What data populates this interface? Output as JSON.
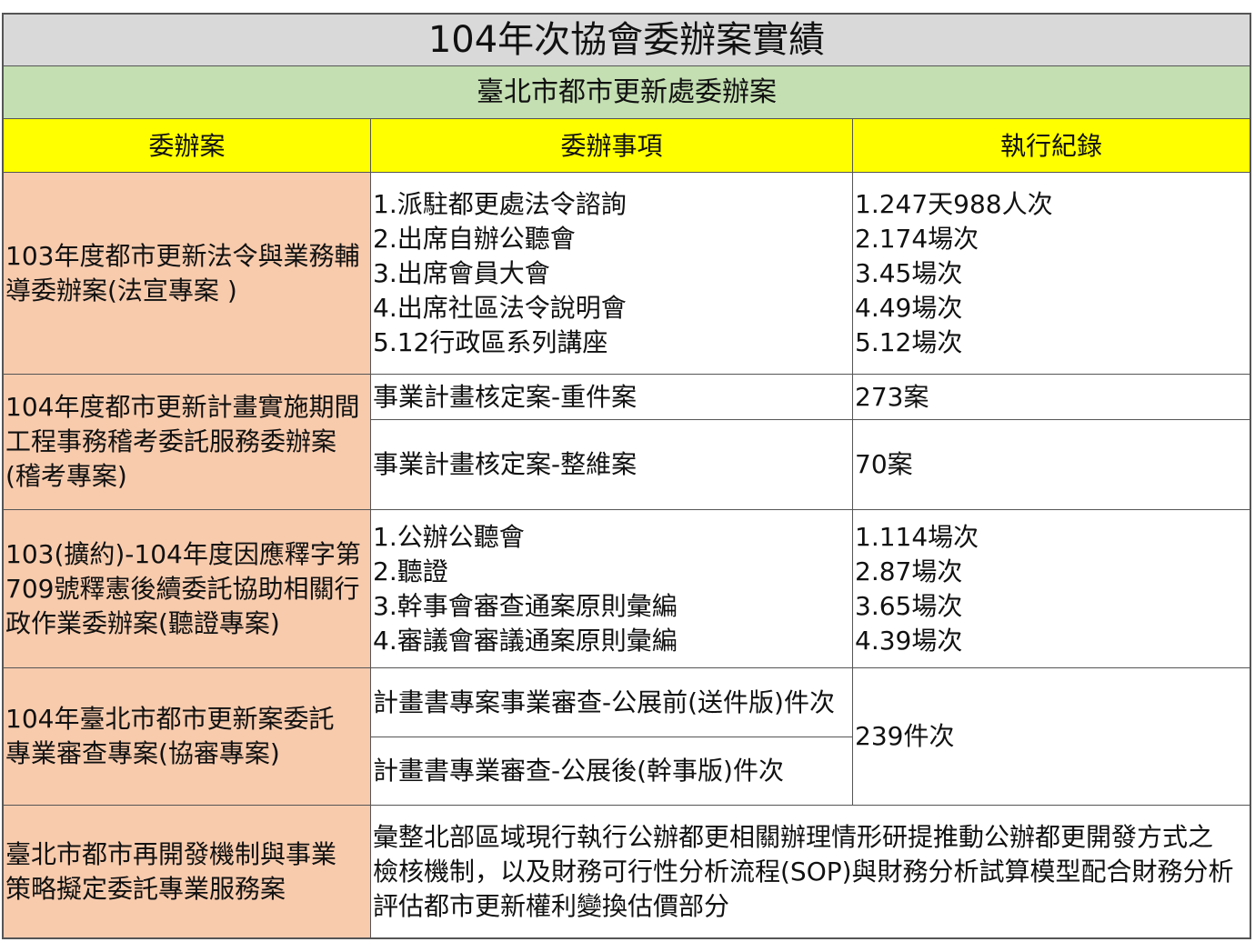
{
  "title": "104年次協會委辦案實績",
  "subtitle": "臺北市都市更新處委辦案",
  "headers": [
    "委辦案",
    "委辦事項",
    "執行紀錄"
  ],
  "rows": [
    {
      "case": "103年度都市更新法令與業務輔導委辦案(法宣專案 )",
      "items": [
        "1.派駐都更處法令諮詢",
        "2.出席自辦公聽會",
        "3.出席會員大會",
        "4.出席社區法令說明會",
        "5.12行政區系列講座"
      ],
      "records": [
        "1.247天988人次",
        "2.174場次",
        "3.45場次",
        "4.49場次",
        "5.12場次"
      ]
    },
    {
      "case": "104年度都市更新計畫實施期間工程事務稽考委託服務委辦案(稽考專案)",
      "sub": [
        {
          "item": "事業計畫核定案-重件案",
          "record": "273案"
        },
        {
          "item": "事業計畫核定案-整維案",
          "record": "70案"
        }
      ]
    },
    {
      "case": "103(擴約)-104年度因應釋字第709號釋憲後續委託協助相關行政作業委辦案(聽證專案)",
      "items": [
        "1.公辦公聽會",
        "2.聽證",
        "3.幹事會審查通案原則彙編",
        "4.審議會審議通案原則彙編"
      ],
      "records": [
        "1.114場次",
        "2.87場次",
        "3.65場次",
        "4.39場次"
      ]
    },
    {
      "case": "104年臺北市都市更新案委託專業審查專案(協審專案)",
      "items": [
        "計畫書專案事業審查-公展前(送件版)件次",
        "計畫書專業審查-公展後(幹事版)件次"
      ],
      "record": "239件次"
    },
    {
      "case": "臺北市都市再開發機制與事業策略擬定委託專業服務案",
      "description": "彙整北部區域現行執行公辦都更相關辦理情形研提推動公辦都更開發方式之檢核機制，以及財務可行性分析流程(SOP)與財務分析試算模型配合財務分析評估都市更新權利變換估價部分"
    }
  ]
}
